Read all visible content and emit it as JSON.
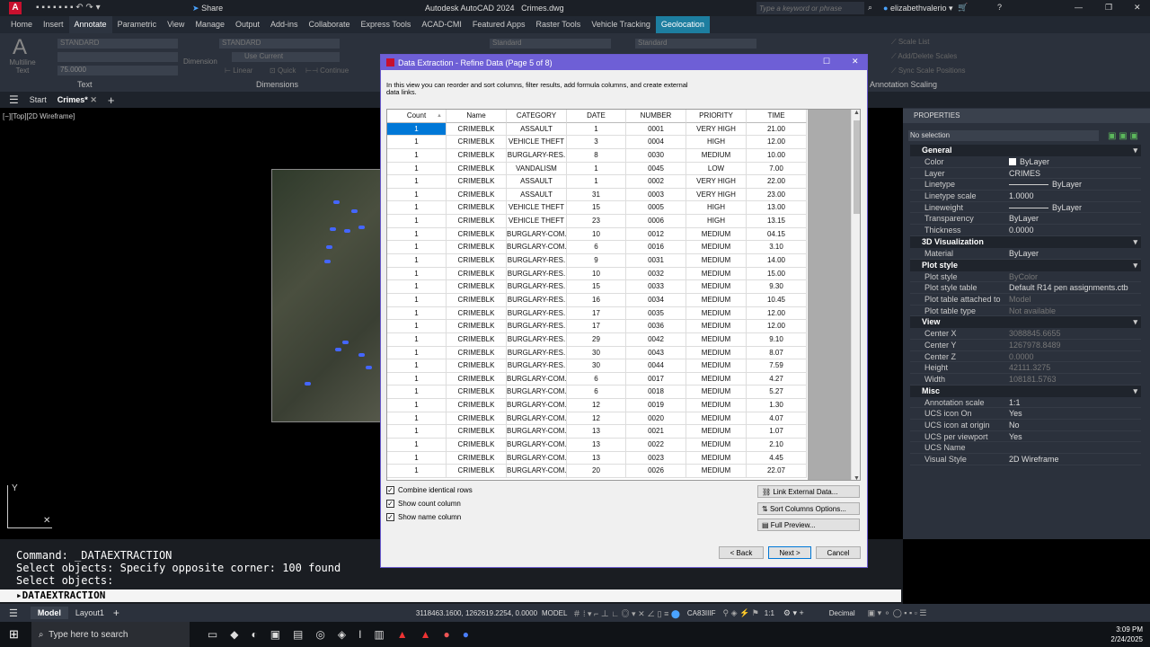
{
  "app": {
    "title": "Autodesk AutoCAD 2024",
    "file": "Crimes.dwg",
    "share": "Share",
    "search_placeholder": "Type a keyword or phrase",
    "user": "elizabethvalerio"
  },
  "ribbon_tabs": [
    "Home",
    "Insert",
    "Annotate",
    "Parametric",
    "View",
    "Manage",
    "Output",
    "Add-ins",
    "Collaborate",
    "Express Tools",
    "ACAD-CMI",
    "Featured Apps",
    "Raster Tools",
    "Vehicle Tracking",
    "Geolocation"
  ],
  "active_ribbon_tab": "Annotate",
  "ribbon": {
    "text_style": "STANDARD",
    "text_height": "75.0000",
    "multiline_text": "Multiline Text",
    "text_panel": "Text",
    "dim_style": "STANDARD",
    "dim_layer": "Use Current",
    "dimension": "Dimension",
    "linear": "Linear",
    "quick": "Quick",
    "continue": "Continue",
    "dimensions_panel": "Dimensions",
    "leader_style": "Standard",
    "table_style": "Standard",
    "scale_list": "Scale List",
    "add_delete_scales": "Add/Delete Scales",
    "sync_scale_positions": "Sync Scale Positions",
    "annotation_scaling": "Annotation Scaling"
  },
  "doc_tabs": {
    "start": "Start",
    "current": "Crimes*"
  },
  "viewport_label": "[−][Top][2D Wireframe]",
  "command": {
    "lines": [
      "Command: _DATAEXTRACTION",
      "Select objects: Specify opposite corner: 100 found",
      "Select objects:"
    ],
    "input": "DATAEXTRACTION"
  },
  "properties": {
    "title": "PROPERTIES",
    "selection": "No selection",
    "sections": [
      {
        "name": "General",
        "rows": [
          [
            "Color",
            "ByLayer"
          ],
          [
            "Layer",
            "CRIMES"
          ],
          [
            "Linetype",
            "ByLayer"
          ],
          [
            "Linetype scale",
            "1.0000"
          ],
          [
            "Lineweight",
            "ByLayer"
          ],
          [
            "Transparency",
            "ByLayer"
          ],
          [
            "Thickness",
            "0.0000"
          ]
        ]
      },
      {
        "name": "3D Visualization",
        "rows": [
          [
            "Material",
            "ByLayer"
          ]
        ]
      },
      {
        "name": "Plot style",
        "rows": [
          [
            "Plot style",
            "ByColor"
          ],
          [
            "Plot style table",
            "Default R14 pen assignments.ctb"
          ],
          [
            "Plot table attached to",
            "Model"
          ],
          [
            "Plot table type",
            "Not available"
          ]
        ]
      },
      {
        "name": "View",
        "rows": [
          [
            "Center X",
            "3088845.6655"
          ],
          [
            "Center Y",
            "1267978.8489"
          ],
          [
            "Center Z",
            "0.0000"
          ],
          [
            "Height",
            "42111.3275"
          ],
          [
            "Width",
            "108181.5763"
          ]
        ]
      },
      {
        "name": "Misc",
        "rows": [
          [
            "Annotation scale",
            "1:1"
          ],
          [
            "UCS icon On",
            "Yes"
          ],
          [
            "UCS icon at origin",
            "No"
          ],
          [
            "UCS per viewport",
            "Yes"
          ],
          [
            "UCS Name",
            ""
          ],
          [
            "Visual Style",
            "2D Wireframe"
          ]
        ]
      }
    ]
  },
  "dialog": {
    "title": "Data Extraction - Refine Data (Page 5 of 8)",
    "description": "In this view you can reorder and sort columns, filter results, add formula columns, and create external data links.",
    "columns": [
      "Count",
      "Name",
      "CATEGORY",
      "DATE",
      "NUMBER",
      "PRIORITY",
      "TIME"
    ],
    "rows": [
      [
        "1",
        "CRIMEBLK",
        "ASSAULT",
        "1",
        "0001",
        "VERY HIGH",
        "21.00"
      ],
      [
        "1",
        "CRIMEBLK",
        "VEHICLE THEFT",
        "3",
        "0004",
        "HIGH",
        "12.00"
      ],
      [
        "1",
        "CRIMEBLK",
        "BURGLARY-RES.",
        "8",
        "0030",
        "MEDIUM",
        "10.00"
      ],
      [
        "1",
        "CRIMEBLK",
        "VANDALISM",
        "1",
        "0045",
        "LOW",
        "7.00"
      ],
      [
        "1",
        "CRIMEBLK",
        "ASSAULT",
        "1",
        "0002",
        "VERY HIGH",
        "22.00"
      ],
      [
        "1",
        "CRIMEBLK",
        "ASSAULT",
        "31",
        "0003",
        "VERY HIGH",
        "23.00"
      ],
      [
        "1",
        "CRIMEBLK",
        "VEHICLE THEFT",
        "15",
        "0005",
        "HIGH",
        "13.00"
      ],
      [
        "1",
        "CRIMEBLK",
        "VEHICLE THEFT",
        "23",
        "0006",
        "HIGH",
        "13.15"
      ],
      [
        "1",
        "CRIMEBLK",
        "BURGLARY-COM.",
        "10",
        "0012",
        "MEDIUM",
        "04.15"
      ],
      [
        "1",
        "CRIMEBLK",
        "BURGLARY-COM.",
        "6",
        "0016",
        "MEDIUM",
        "3.10"
      ],
      [
        "1",
        "CRIMEBLK",
        "BURGLARY-RES.",
        "9",
        "0031",
        "MEDIUM",
        "14.00"
      ],
      [
        "1",
        "CRIMEBLK",
        "BURGLARY-RES.",
        "10",
        "0032",
        "MEDIUM",
        "15.00"
      ],
      [
        "1",
        "CRIMEBLK",
        "BURGLARY-RES.",
        "15",
        "0033",
        "MEDIUM",
        "9.30"
      ],
      [
        "1",
        "CRIMEBLK",
        "BURGLARY-RES.",
        "16",
        "0034",
        "MEDIUM",
        "10.45"
      ],
      [
        "1",
        "CRIMEBLK",
        "BURGLARY-RES.",
        "17",
        "0035",
        "MEDIUM",
        "12.00"
      ],
      [
        "1",
        "CRIMEBLK",
        "BURGLARY-RES.",
        "17",
        "0036",
        "MEDIUM",
        "12.00"
      ],
      [
        "1",
        "CRIMEBLK",
        "BURGLARY-RES.",
        "29",
        "0042",
        "MEDIUM",
        "9.10"
      ],
      [
        "1",
        "CRIMEBLK",
        "BURGLARY-RES.",
        "30",
        "0043",
        "MEDIUM",
        "8.07"
      ],
      [
        "1",
        "CRIMEBLK",
        "BURGLARY-RES.",
        "30",
        "0044",
        "MEDIUM",
        "7.59"
      ],
      [
        "1",
        "CRIMEBLK",
        "BURGLARY-COM.",
        "6",
        "0017",
        "MEDIUM",
        "4.27"
      ],
      [
        "1",
        "CRIMEBLK",
        "BURGLARY-COM.",
        "6",
        "0018",
        "MEDIUM",
        "5.27"
      ],
      [
        "1",
        "CRIMEBLK",
        "BURGLARY-COM.",
        "12",
        "0019",
        "MEDIUM",
        "1.30"
      ],
      [
        "1",
        "CRIMEBLK",
        "BURGLARY-COM.",
        "12",
        "0020",
        "MEDIUM",
        "4.07"
      ],
      [
        "1",
        "CRIMEBLK",
        "BURGLARY-COM.",
        "13",
        "0021",
        "MEDIUM",
        "1.07"
      ],
      [
        "1",
        "CRIMEBLK",
        "BURGLARY-COM.",
        "13",
        "0022",
        "MEDIUM",
        "2.10"
      ],
      [
        "1",
        "CRIMEBLK",
        "BURGLARY-COM.",
        "13",
        "0023",
        "MEDIUM",
        "4.45"
      ],
      [
        "1",
        "CRIMEBLK",
        "BURGLARY-COM.",
        "20",
        "0026",
        "MEDIUM",
        "22.07"
      ]
    ],
    "checkboxes": [
      {
        "label": "Combine identical rows",
        "checked": true
      },
      {
        "label": "Show count column",
        "checked": true
      },
      {
        "label": "Show name column",
        "checked": true
      }
    ],
    "link_external": "Link External Data...",
    "sort_columns": "Sort Columns Options...",
    "full_preview": "Full Preview...",
    "back": "< Back",
    "next": "Next >",
    "cancel": "Cancel"
  },
  "status": {
    "coords": "3118463.1600, 1262619.2254, 0.0000",
    "model": "MODEL",
    "coord_system": "CA83IIIF",
    "scale": "1:1",
    "units": "Decimal",
    "model_tab": "Model",
    "layout_tab": "Layout1"
  },
  "taskbar": {
    "search": "Type here to search",
    "time": "3:09 PM",
    "date": "2/24/2025"
  },
  "colors": {
    "dialog_title": "#6e5fd6",
    "geolocation_tab": "#1d7ea0",
    "selection": "#0078d7"
  }
}
